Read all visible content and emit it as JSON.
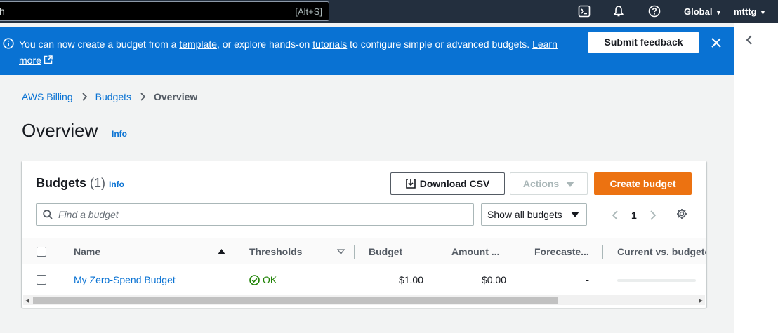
{
  "topbar": {
    "search_typed": "h",
    "search_shortcut": "[Alt+S]",
    "region_label": "Global",
    "account_label": "mtttg"
  },
  "flash": {
    "text_1": "You can now create a budget from a ",
    "link_template": "template",
    "text_2": ", or explore hands-on ",
    "link_tutorials": "tutorials",
    "text_3": " to configure simple or advanced budgets. ",
    "link_learn_more": "Learn more",
    "feedback_button": "Submit feedback"
  },
  "breadcrumb": {
    "items": [
      "AWS Billing",
      "Budgets"
    ],
    "current": "Overview"
  },
  "page": {
    "title": "Overview",
    "info": "Info"
  },
  "budgets_panel": {
    "title": "Budgets",
    "count": "(1)",
    "info": "Info",
    "download_csv": "Download CSV",
    "actions": "Actions",
    "create_budget": "Create budget",
    "search_placeholder": "Find a budget",
    "filter_selected": "Show all budgets",
    "current_page": "1"
  },
  "table": {
    "columns": [
      "Name",
      "Thresholds",
      "Budget",
      "Amount ...",
      "Forecaste...",
      "Current vs. budgete"
    ],
    "rows": [
      {
        "name": "My Zero-Spend Budget",
        "thresholds": "OK",
        "budget": "$1.00",
        "amount": "$0.00",
        "forecasted": "-",
        "current_vs_budgeted_fraction": 0
      }
    ]
  },
  "colors": {
    "topbar": "#232f3e",
    "flash": "#0972d3",
    "primary_button": "#ec7211",
    "link": "#0972d3",
    "ok": "#1d8102"
  },
  "icons": [
    "cloudshell-icon",
    "bell-icon",
    "help-icon",
    "info-icon",
    "external-link-icon",
    "close-icon",
    "chevron-left-icon",
    "chevron-right-icon",
    "download-icon",
    "caret-down-icon",
    "search-icon",
    "gear-icon",
    "sort-asc-icon",
    "status-ok-icon"
  ]
}
